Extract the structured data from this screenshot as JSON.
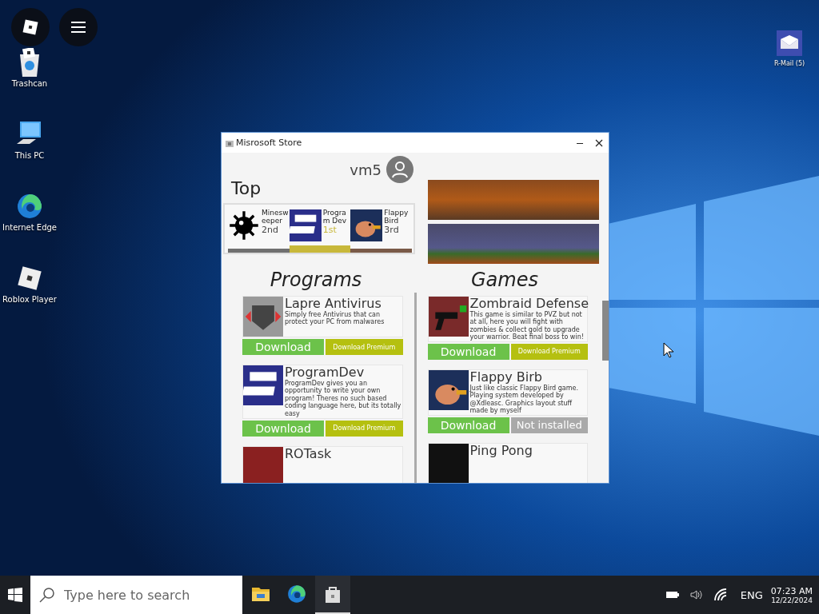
{
  "overlay_buttons": [
    {
      "kind": "logo"
    },
    {
      "kind": "menu"
    }
  ],
  "desktop_icons": [
    {
      "label": "Trashcan",
      "kind": "trash"
    },
    {
      "label": "This PC",
      "kind": "pc"
    },
    {
      "label": "Internet Edge",
      "kind": "edge"
    },
    {
      "label": "Roblox Player",
      "kind": "roblox"
    }
  ],
  "desktop_icons_right": [
    {
      "label": "R-Mail (5)",
      "kind": "mail"
    }
  ],
  "window": {
    "title": "Misrosoft Store",
    "username": "vm5",
    "top_heading": "Top",
    "top_items": [
      {
        "name": "Minesweeper",
        "rank": "2nd",
        "kind": "mine",
        "color": "#707070",
        "selected": false
      },
      {
        "name": "Program Dev",
        "rank": "1st",
        "kind": "dev",
        "color": "#c8b83a",
        "selected": true
      },
      {
        "name": "Flappy Bird",
        "rank": "3rd",
        "kind": "bird",
        "color": "#7a5a48",
        "selected": false
      }
    ],
    "sections": [
      {
        "heading": "Programs",
        "items": [
          {
            "title": "Lapre Antivirus",
            "kind": "la",
            "description": "Simply free Antivirus that can protect your PC from malwares",
            "buttons": [
              {
                "label": "Download",
                "kind": "download"
              },
              {
                "label": "Download Premium",
                "kind": "premium"
              }
            ]
          },
          {
            "title": "ProgramDev",
            "kind": "dev",
            "description": "ProgramDev gives you an opportunity to write your own program! Theres no such based coding language here, but its totally easy",
            "buttons": [
              {
                "label": "Download",
                "kind": "download"
              },
              {
                "label": "Download Premium",
                "kind": "premium"
              }
            ]
          },
          {
            "title": "ROTask",
            "kind": "red"
          }
        ]
      },
      {
        "heading": "Games",
        "items": [
          {
            "title": "Zombraid Defense",
            "kind": "zd",
            "description": "This game is similar to PVZ but not at all, here you will fight with zombies & collect gold to upgrade your warrior. Beat final boss to win!",
            "buttons": [
              {
                "label": "Download",
                "kind": "download"
              },
              {
                "label": "Download Premium",
                "kind": "premium"
              }
            ]
          },
          {
            "title": "Flappy Birb",
            "kind": "bird",
            "description": "Just like classic Flappy Bird game. Playing system developed by @Xdleasc. Graphics layout stuff made by myself",
            "buttons": [
              {
                "label": "Download",
                "kind": "download"
              },
              {
                "label": "Not installed",
                "kind": "disabled"
              }
            ]
          },
          {
            "title": "Ping Pong",
            "kind": "black"
          }
        ]
      }
    ]
  },
  "taskbar": {
    "search_placeholder": "Type here to search",
    "apps": [
      {
        "kind": "folder",
        "selected": false
      },
      {
        "kind": "edge",
        "selected": false
      },
      {
        "kind": "store",
        "selected": true
      }
    ],
    "language": "ENG",
    "time": "07:23 AM",
    "date": "12/22/2024"
  }
}
